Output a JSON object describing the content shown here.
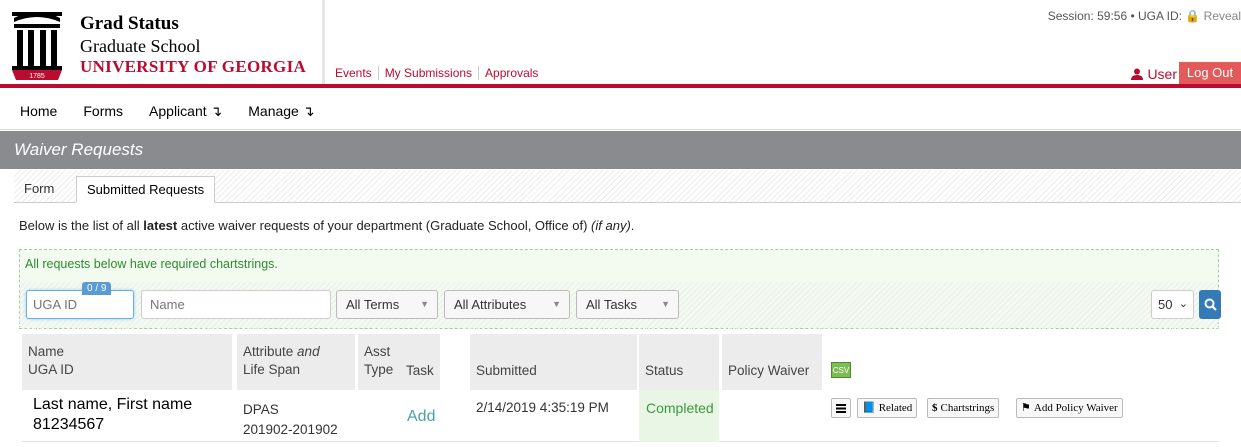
{
  "brand": {
    "title": "Grad Status",
    "subtitle": "Graduate School",
    "university": "UNIVERSITY OF GEORGIA",
    "logo_year": "1785"
  },
  "topnav": [
    "Events",
    "My Submissions",
    "Approvals"
  ],
  "session": {
    "text": "Session: 59:56 • UGA ID: ",
    "reveal": "Reveal"
  },
  "user": {
    "label": "User",
    "logout": "Log Out"
  },
  "mainnav": {
    "home": "Home",
    "forms": "Forms",
    "applicant": "Applicant ↴",
    "manage": "Manage ↴"
  },
  "page_title": "Waiver Requests",
  "tabs": {
    "form": "Form",
    "submitted": "Submitted Requests"
  },
  "description": {
    "prefix": "Below is the list of all ",
    "bold": "latest",
    "middle": " active waiver requests of your department (Graduate School, Office of) ",
    "italic": "(if any)",
    "suffix": "."
  },
  "alert_text": "All requests below have required chartstrings.",
  "filters": {
    "uga_placeholder": "UGA ID",
    "counter": "0 / 9",
    "name_placeholder": "Name",
    "terms": "All Terms",
    "attributes": "All Attributes",
    "tasks": "All Tasks",
    "page_size": "50"
  },
  "table": {
    "headers": {
      "name": "Name",
      "uga_id": "UGA ID",
      "attribute": "Attribute",
      "and": "and",
      "life_span": "Life Span",
      "asst": "Asst",
      "type": "Type",
      "task": "Task",
      "submitted": "Submitted",
      "status": "Status",
      "policy_waiver": "Policy Waiver"
    },
    "csv_label": "CSV",
    "rows": [
      {
        "name": "Last name, First name",
        "uga_id": "81234567",
        "attribute": "DPAS",
        "life_span": "201902-201902",
        "task": "Add",
        "submitted": "2/14/2019 4:35:19 PM",
        "status": "Completed"
      }
    ],
    "actions": {
      "related": "Related",
      "chartstrings": "Chartstrings",
      "add_policy_waiver": "Add Policy Waiver"
    }
  },
  "colors": {
    "brand_red": "#ba0c2f",
    "title_bar": "#8a8b8f",
    "status_green": "#3a9a3a",
    "primary_blue": "#337ab7"
  }
}
